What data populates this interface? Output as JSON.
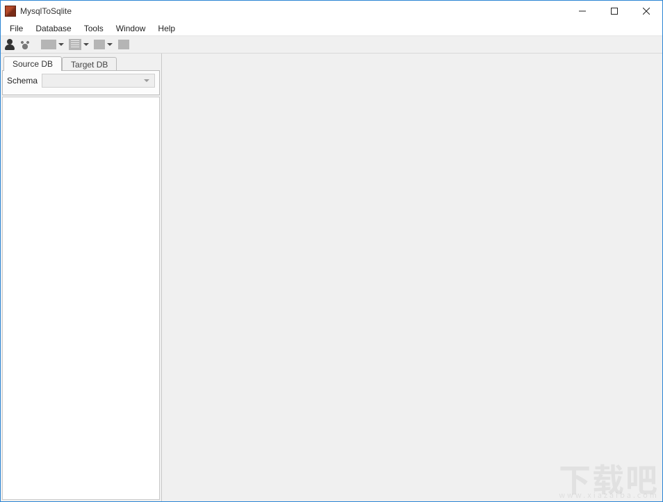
{
  "app": {
    "title": "MysqlToSqlite"
  },
  "menu": {
    "items": [
      "File",
      "Database",
      "Tools",
      "Window",
      "Help"
    ]
  },
  "toolbar": {
    "btn1_name": "user-icon",
    "btn2_name": "paw-icon",
    "btn3_name": "page-icon",
    "btn4_name": "sql-icon",
    "btn5_name": "page-icon",
    "btn6_name": "page-icon"
  },
  "side": {
    "tabs": [
      {
        "label": "Source DB",
        "active": true
      },
      {
        "label": "Target DB",
        "active": false
      }
    ],
    "schema_label": "Schema",
    "schema_value": ""
  },
  "watermark": {
    "text": "下载吧",
    "sub": "www.xiazaiba.com"
  }
}
